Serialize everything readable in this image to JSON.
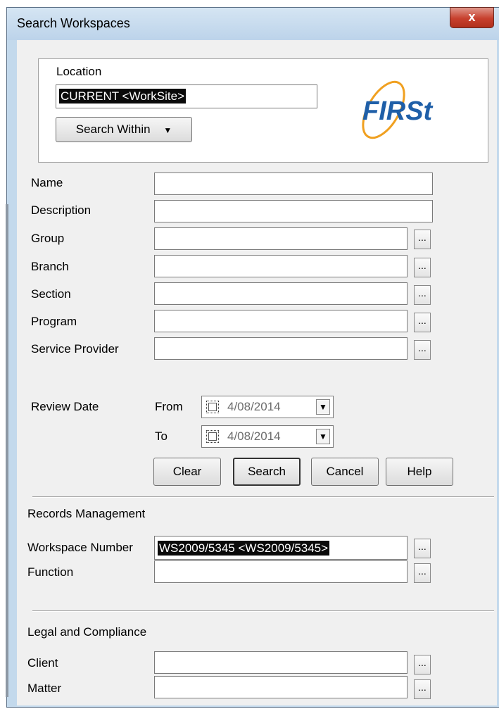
{
  "window": {
    "title": "Search Workspaces",
    "close_glyph": "x"
  },
  "location": {
    "label": "Location",
    "value": "CURRENT <WorkSite>",
    "search_within_label": "Search Within",
    "logo_text": "FIRSt"
  },
  "fields": {
    "name": {
      "label": "Name",
      "value": ""
    },
    "description": {
      "label": "Description",
      "value": ""
    },
    "group": {
      "label": "Group",
      "value": ""
    },
    "branch": {
      "label": "Branch",
      "value": ""
    },
    "section": {
      "label": "Section",
      "value": ""
    },
    "program": {
      "label": "Program",
      "value": ""
    },
    "service_provider": {
      "label": "Service Provider",
      "value": ""
    }
  },
  "ellipsis": "...",
  "review_date": {
    "label": "Review Date",
    "from_label": "From",
    "from_value": "4/08/2014",
    "to_label": "To",
    "to_value": "4/08/2014"
  },
  "buttons": {
    "clear": "Clear",
    "search": "Search",
    "cancel": "Cancel",
    "help": "Help"
  },
  "records": {
    "heading": "Records Management",
    "workspace_number_label": "Workspace Number",
    "workspace_number_value": "WS2009/5345 <WS2009/5345>",
    "function_label": "Function",
    "function_value": ""
  },
  "legal": {
    "heading": "Legal and Compliance",
    "client_label": "Client",
    "client_value": "",
    "matter_label": "Matter",
    "matter_value": ""
  },
  "colors": {
    "accent_blue": "#1f5fa8",
    "logo_orange": "#f0a020",
    "close_red": "#c7402d"
  }
}
